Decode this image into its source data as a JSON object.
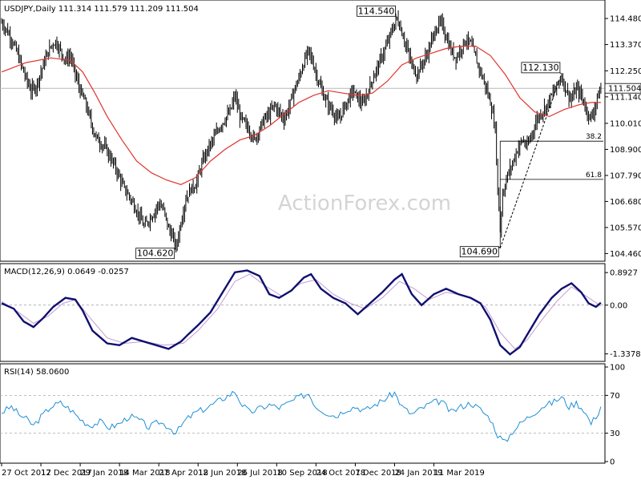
{
  "chart_data": [
    {
      "type": "candlestick",
      "title": "USDJPY,Daily 111.314 111.579 111.209 111.504",
      "watermark": "ActionForex.com",
      "y_ticks": [
        "114.480",
        "113.370",
        "112.250",
        "111.140",
        "110.010",
        "108.900",
        "107.790",
        "106.680",
        "105.570",
        "104.460"
      ],
      "y_tick_values": [
        114.48,
        113.37,
        112.25,
        111.14,
        110.01,
        108.9,
        107.79,
        106.68,
        105.57,
        104.46
      ],
      "ylim": [
        104.2,
        115.2
      ],
      "current_price": "111.504",
      "current_value": 111.504,
      "close_path": [
        [
          0,
          114.3
        ],
        [
          4,
          114.0
        ],
        [
          8,
          113.6
        ],
        [
          12,
          113.1
        ],
        [
          16,
          112.5
        ],
        [
          20,
          111.9
        ],
        [
          24,
          111.4
        ],
        [
          28,
          111.6
        ],
        [
          32,
          112.2
        ],
        [
          36,
          112.8
        ],
        [
          40,
          113.3
        ],
        [
          44,
          113.5
        ],
        [
          48,
          113.1
        ],
        [
          52,
          112.7
        ],
        [
          56,
          112.9
        ],
        [
          60,
          112.1
        ],
        [
          64,
          111.4
        ],
        [
          68,
          110.9
        ],
        [
          72,
          110.2
        ],
        [
          76,
          109.5
        ],
        [
          80,
          109.2
        ],
        [
          84,
          109.0
        ],
        [
          88,
          108.6
        ],
        [
          92,
          108.2
        ],
        [
          96,
          107.7
        ],
        [
          100,
          107.2
        ],
        [
          104,
          106.9
        ],
        [
          108,
          106.5
        ],
        [
          112,
          106.1
        ],
        [
          116,
          105.6
        ],
        [
          120,
          105.9
        ],
        [
          124,
          106.2
        ],
        [
          128,
          106.6
        ],
        [
          132,
          106.3
        ],
        [
          136,
          105.5
        ],
        [
          140,
          105.1
        ],
        [
          142,
          104.7
        ],
        [
          146,
          105.8
        ],
        [
          150,
          106.8
        ],
        [
          154,
          107.2
        ],
        [
          158,
          107.4
        ],
        [
          162,
          108.1
        ],
        [
          166,
          108.7
        ],
        [
          170,
          109.1
        ],
        [
          174,
          109.5
        ],
        [
          178,
          109.9
        ],
        [
          182,
          110.2
        ],
        [
          186,
          110.5
        ],
        [
          190,
          111.2
        ],
        [
          194,
          110.3
        ],
        [
          198,
          110.0
        ],
        [
          202,
          109.7
        ],
        [
          206,
          109.3
        ],
        [
          210,
          109.8
        ],
        [
          214,
          110.2
        ],
        [
          218,
          110.4
        ],
        [
          222,
          110.8
        ],
        [
          226,
          110.5
        ],
        [
          230,
          110.2
        ],
        [
          234,
          110.7
        ],
        [
          238,
          111.4
        ],
        [
          242,
          111.9
        ],
        [
          246,
          112.6
        ],
        [
          250,
          113.1
        ],
        [
          254,
          112.5
        ],
        [
          258,
          111.8
        ],
        [
          262,
          111.2
        ],
        [
          266,
          110.8
        ],
        [
          270,
          110.5
        ],
        [
          274,
          110.1
        ],
        [
          278,
          110.6
        ],
        [
          282,
          111.0
        ],
        [
          286,
          111.4
        ],
        [
          290,
          111.1
        ],
        [
          294,
          110.8
        ],
        [
          298,
          111.3
        ],
        [
          302,
          111.9
        ],
        [
          306,
          112.4
        ],
        [
          310,
          112.9
        ],
        [
          314,
          113.4
        ],
        [
          318,
          114.0
        ],
        [
          322,
          114.5
        ],
        [
          326,
          113.9
        ],
        [
          330,
          113.2
        ],
        [
          334,
          112.5
        ],
        [
          338,
          112.1
        ],
        [
          342,
          112.5
        ],
        [
          346,
          112.9
        ],
        [
          350,
          113.5
        ],
        [
          354,
          114.1
        ],
        [
          358,
          114.3
        ],
        [
          362,
          113.7
        ],
        [
          366,
          113.1
        ],
        [
          370,
          112.8
        ],
        [
          374,
          113.2
        ],
        [
          378,
          113.6
        ],
        [
          382,
          113.4
        ],
        [
          386,
          112.8
        ],
        [
          390,
          112.2
        ],
        [
          394,
          111.6
        ],
        [
          398,
          110.9
        ],
        [
          402,
          109.8
        ],
        [
          404,
          107.2
        ],
        [
          406,
          105.5
        ],
        [
          408,
          107.0
        ],
        [
          412,
          107.8
        ],
        [
          416,
          108.3
        ],
        [
          420,
          108.9
        ],
        [
          424,
          109.3
        ],
        [
          428,
          109.0
        ],
        [
          432,
          109.6
        ],
        [
          436,
          110.2
        ],
        [
          440,
          110.5
        ],
        [
          444,
          110.8
        ],
        [
          448,
          111.2
        ],
        [
          452,
          111.6
        ],
        [
          456,
          112.0
        ],
        [
          460,
          111.4
        ],
        [
          464,
          111.0
        ],
        [
          468,
          111.5
        ],
        [
          472,
          111.2
        ],
        [
          476,
          110.6
        ],
        [
          480,
          110.2
        ],
        [
          484,
          110.9
        ],
        [
          488,
          111.504
        ]
      ],
      "ma_path": [
        [
          0,
          112.2
        ],
        [
          20,
          112.6
        ],
        [
          40,
          112.8
        ],
        [
          56,
          112.7
        ],
        [
          66,
          112.2
        ],
        [
          76,
          111.3
        ],
        [
          86,
          110.3
        ],
        [
          98,
          109.3
        ],
        [
          110,
          108.4
        ],
        [
          122,
          107.9
        ],
        [
          134,
          107.6
        ],
        [
          146,
          107.4
        ],
        [
          158,
          107.7
        ],
        [
          170,
          108.4
        ],
        [
          182,
          108.9
        ],
        [
          194,
          109.3
        ],
        [
          206,
          109.5
        ],
        [
          218,
          109.9
        ],
        [
          230,
          110.4
        ],
        [
          242,
          110.9
        ],
        [
          254,
          111.2
        ],
        [
          266,
          111.4
        ],
        [
          278,
          111.3
        ],
        [
          290,
          111.2
        ],
        [
          302,
          111.3
        ],
        [
          314,
          111.8
        ],
        [
          326,
          112.5
        ],
        [
          338,
          112.8
        ],
        [
          350,
          113.0
        ],
        [
          362,
          113.2
        ],
        [
          374,
          113.3
        ],
        [
          386,
          113.3
        ],
        [
          398,
          112.9
        ],
        [
          410,
          112.1
        ],
        [
          422,
          111.1
        ],
        [
          434,
          110.5
        ],
        [
          446,
          110.3
        ],
        [
          458,
          110.6
        ],
        [
          470,
          110.8
        ],
        [
          480,
          110.9
        ],
        [
          488,
          110.9
        ]
      ],
      "annotations": [
        {
          "text": "114.540",
          "x": 322,
          "y": 114.54
        },
        {
          "text": "104.620",
          "x": 142,
          "y": 104.62
        },
        {
          "text": "104.690",
          "x": 406,
          "y": 104.69
        },
        {
          "text": "112.130",
          "x": 456,
          "y": 112.13
        }
      ],
      "fib_levels": [
        {
          "label": "38.2",
          "value": 109.25,
          "x_start": 406
        },
        {
          "label": "61.8",
          "value": 107.62,
          "x_start": 406
        }
      ],
      "trendline": {
        "x0": 406,
        "y0": 104.69,
        "x1": 456,
        "y1": 112.13
      },
      "vertical_line": {
        "x": 406,
        "y0": 104.69,
        "y1": 109.25
      }
    },
    {
      "type": "line",
      "title": "MACD(12,26,9) 0.0649 -0.0257",
      "y_ticks": [
        "0.8927",
        "0.00",
        "-1.3378"
      ],
      "y_tick_values": [
        0.8927,
        0.0,
        -1.3378
      ],
      "ylim": [
        -1.5,
        1.05
      ],
      "macd_path": [
        [
          0,
          0.05
        ],
        [
          10,
          -0.1
        ],
        [
          18,
          -0.45
        ],
        [
          26,
          -0.6
        ],
        [
          34,
          -0.35
        ],
        [
          42,
          -0.05
        ],
        [
          52,
          0.2
        ],
        [
          60,
          0.15
        ],
        [
          66,
          -0.15
        ],
        [
          74,
          -0.7
        ],
        [
          86,
          -1.05
        ],
        [
          96,
          -1.1
        ],
        [
          106,
          -0.9
        ],
        [
          116,
          -1.0
        ],
        [
          126,
          -1.1
        ],
        [
          136,
          -1.2
        ],
        [
          146,
          -1.0
        ],
        [
          152,
          -0.8
        ],
        [
          160,
          -0.55
        ],
        [
          170,
          -0.2
        ],
        [
          180,
          0.35
        ],
        [
          190,
          0.9
        ],
        [
          200,
          0.95
        ],
        [
          210,
          0.8
        ],
        [
          218,
          0.3
        ],
        [
          226,
          0.2
        ],
        [
          236,
          0.4
        ],
        [
          246,
          0.75
        ],
        [
          252,
          0.85
        ],
        [
          260,
          0.45
        ],
        [
          270,
          0.2
        ],
        [
          280,
          0.05
        ],
        [
          290,
          -0.25
        ],
        [
          300,
          0.05
        ],
        [
          310,
          0.35
        ],
        [
          320,
          0.7
        ],
        [
          326,
          0.85
        ],
        [
          334,
          0.3
        ],
        [
          342,
          0.0
        ],
        [
          352,
          0.3
        ],
        [
          362,
          0.45
        ],
        [
          372,
          0.3
        ],
        [
          382,
          0.2
        ],
        [
          390,
          0.05
        ],
        [
          398,
          -0.4
        ],
        [
          406,
          -1.1
        ],
        [
          414,
          -1.35
        ],
        [
          422,
          -1.15
        ],
        [
          430,
          -0.7
        ],
        [
          438,
          -0.25
        ],
        [
          448,
          0.2
        ],
        [
          456,
          0.45
        ],
        [
          464,
          0.6
        ],
        [
          472,
          0.35
        ],
        [
          478,
          0.05
        ],
        [
          484,
          -0.05
        ],
        [
          488,
          0.065
        ]
      ],
      "signal_path": [
        [
          0,
          0.1
        ],
        [
          14,
          -0.2
        ],
        [
          26,
          -0.5
        ],
        [
          38,
          -0.3
        ],
        [
          50,
          0.05
        ],
        [
          60,
          0.15
        ],
        [
          72,
          -0.35
        ],
        [
          86,
          -0.9
        ],
        [
          100,
          -1.05
        ],
        [
          116,
          -1.0
        ],
        [
          132,
          -1.1
        ],
        [
          148,
          -1.05
        ],
        [
          160,
          -0.7
        ],
        [
          176,
          -0.1
        ],
        [
          190,
          0.65
        ],
        [
          202,
          0.85
        ],
        [
          216,
          0.5
        ],
        [
          228,
          0.25
        ],
        [
          244,
          0.6
        ],
        [
          256,
          0.7
        ],
        [
          270,
          0.3
        ],
        [
          284,
          0.05
        ],
        [
          296,
          -0.1
        ],
        [
          310,
          0.2
        ],
        [
          324,
          0.65
        ],
        [
          336,
          0.45
        ],
        [
          348,
          0.15
        ],
        [
          362,
          0.35
        ],
        [
          378,
          0.25
        ],
        [
          394,
          -0.05
        ],
        [
          406,
          -0.75
        ],
        [
          418,
          -1.2
        ],
        [
          428,
          -0.95
        ],
        [
          440,
          -0.4
        ],
        [
          452,
          0.1
        ],
        [
          464,
          0.5
        ],
        [
          476,
          0.25
        ],
        [
          488,
          -0.026
        ]
      ]
    },
    {
      "type": "line",
      "title": "RSI(14) 58.0600",
      "y_ticks": [
        "100",
        "70",
        "30",
        "0"
      ],
      "y_tick_values": [
        100,
        70,
        30,
        0
      ],
      "ylim": [
        0,
        100
      ],
      "rsi_path": [
        [
          0,
          52
        ],
        [
          8,
          58
        ],
        [
          14,
          50
        ],
        [
          20,
          45
        ],
        [
          26,
          38
        ],
        [
          32,
          47
        ],
        [
          40,
          58
        ],
        [
          48,
          62
        ],
        [
          56,
          55
        ],
        [
          64,
          45
        ],
        [
          72,
          38
        ],
        [
          80,
          42
        ],
        [
          88,
          36
        ],
        [
          96,
          40
        ],
        [
          104,
          48
        ],
        [
          112,
          44
        ],
        [
          120,
          36
        ],
        [
          128,
          42
        ],
        [
          136,
          37
        ],
        [
          142,
          30
        ],
        [
          150,
          44
        ],
        [
          158,
          52
        ],
        [
          166,
          56
        ],
        [
          174,
          62
        ],
        [
          182,
          68
        ],
        [
          190,
          74
        ],
        [
          196,
          60
        ],
        [
          202,
          52
        ],
        [
          210,
          56
        ],
        [
          218,
          60
        ],
        [
          226,
          57
        ],
        [
          234,
          62
        ],
        [
          242,
          68
        ],
        [
          250,
          72
        ],
        [
          256,
          58
        ],
        [
          264,
          52
        ],
        [
          272,
          48
        ],
        [
          280,
          55
        ],
        [
          288,
          58
        ],
        [
          296,
          54
        ],
        [
          304,
          60
        ],
        [
          312,
          66
        ],
        [
          320,
          73
        ],
        [
          326,
          58
        ],
        [
          334,
          50
        ],
        [
          342,
          56
        ],
        [
          350,
          62
        ],
        [
          358,
          64
        ],
        [
          366,
          52
        ],
        [
          374,
          58
        ],
        [
          382,
          62
        ],
        [
          390,
          55
        ],
        [
          398,
          45
        ],
        [
          404,
          28
        ],
        [
          410,
          20
        ],
        [
          416,
          32
        ],
        [
          424,
          42
        ],
        [
          432,
          50
        ],
        [
          440,
          58
        ],
        [
          448,
          62
        ],
        [
          456,
          68
        ],
        [
          462,
          58
        ],
        [
          468,
          62
        ],
        [
          474,
          55
        ],
        [
          480,
          40
        ],
        [
          486,
          52
        ],
        [
          488,
          58.06
        ]
      ],
      "guide_levels": [
        70,
        30
      ]
    }
  ],
  "x_axis": {
    "labels": [
      "27 Oct 2017",
      "12 Dec 2017",
      "29 Jan 2018",
      "14 Mar 2018",
      "27 Apr 2018",
      "12 Jun 2018",
      "26 Jul 2018",
      "10 Sep 2018",
      "24 Oct 2018",
      "7 Dec 2018",
      "24 Jan 2019",
      "11 Mar 2019"
    ],
    "index": [
      0,
      32,
      64,
      96,
      128,
      160,
      192,
      224,
      256,
      288,
      320,
      352
    ],
    "max_index": 490
  }
}
